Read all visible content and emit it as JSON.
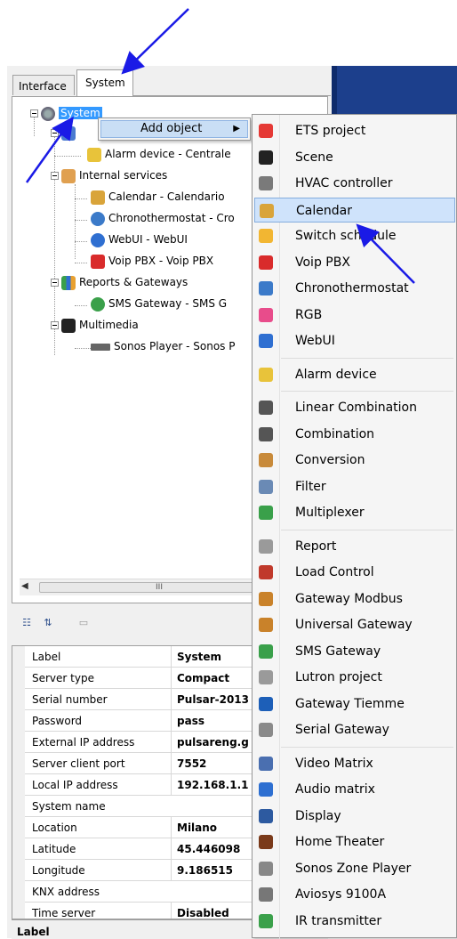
{
  "tabs": [
    "Interface",
    "System"
  ],
  "tree": {
    "root": "System",
    "items": [
      "Alarm device - Centrale",
      "Internal services",
      "Calendar - Calendario",
      "Chronothermostat - Cro",
      "WebUI - WebUI",
      "Voip PBX - Voip PBX",
      "Reports & Gateways",
      "SMS Gateway - SMS G",
      "Multimedia",
      "Sonos Player - Sonos P"
    ]
  },
  "scroll_thumb": "III",
  "context_menu": {
    "label": "Add object",
    "arrow": "▶"
  },
  "submenu": [
    {
      "label": "ETS project",
      "icon": "ets-icon",
      "color": "#e53935"
    },
    {
      "label": "Scene",
      "icon": "clapper-icon",
      "color": "#222222"
    },
    {
      "label": "HVAC controller",
      "icon": "hvac-icon",
      "color": "#7a7a7a"
    },
    {
      "label": "Calendar",
      "icon": "calendar-icon",
      "color": "#d9a43a"
    },
    {
      "label": "Switch schedule",
      "icon": "schedule-icon",
      "color": "#f2b632"
    },
    {
      "label": "Voip PBX",
      "icon": "phone-icon",
      "color": "#d92b2b"
    },
    {
      "label": "Chronothermostat",
      "icon": "thermostat-icon",
      "color": "#3b7ac9"
    },
    {
      "label": "RGB",
      "icon": "rgb-icon",
      "color": "#e84c8b"
    },
    {
      "label": "WebUI",
      "icon": "globe-icon",
      "color": "#2f6fd1"
    },
    {
      "label": "Alarm device",
      "icon": "bell-icon",
      "color": "#e8c33a"
    },
    {
      "label": "Linear Combination",
      "icon": "sigma-icon",
      "color": "#555555"
    },
    {
      "label": "Combination",
      "icon": "combination-icon",
      "color": "#555555"
    },
    {
      "label": "Conversion",
      "icon": "pencil-icon",
      "color": "#c88a3a"
    },
    {
      "label": "Filter",
      "icon": "filter-icon",
      "color": "#6a8ab5"
    },
    {
      "label": "Multiplexer",
      "icon": "multiplexer-icon",
      "color": "#3aa04a"
    },
    {
      "label": "Report",
      "icon": "report-icon",
      "color": "#9a9a9a"
    },
    {
      "label": "Load Control",
      "icon": "load-icon",
      "color": "#c0392b"
    },
    {
      "label": "Gateway Modbus",
      "icon": "modbus-icon",
      "color": "#c9822a"
    },
    {
      "label": "Universal Gateway",
      "icon": "gateway-icon",
      "color": "#c9822a"
    },
    {
      "label": "SMS Gateway",
      "icon": "sms-icon",
      "color": "#3aa04a"
    },
    {
      "label": "Lutron project",
      "icon": "lutron-icon",
      "color": "#9a9a9a"
    },
    {
      "label": "Gateway Tiemme",
      "icon": "tiemme-icon",
      "color": "#1d5fb8"
    },
    {
      "label": "Serial Gateway",
      "icon": "serial-icon",
      "color": "#8a8a8a"
    },
    {
      "label": "Video Matrix",
      "icon": "video-matrix-icon",
      "color": "#4a6fb0"
    },
    {
      "label": "Audio matrix",
      "icon": "music-icon",
      "color": "#2d6fd1"
    },
    {
      "label": "Display",
      "icon": "display-icon",
      "color": "#2d5aa0"
    },
    {
      "label": "Home Theater",
      "icon": "speaker-icon",
      "color": "#7a3a1a"
    },
    {
      "label": "Sonos Zone Player",
      "icon": "sonos-icon",
      "color": "#888888"
    },
    {
      "label": "Aviosys 9100A",
      "icon": "aviosys-icon",
      "color": "#777777"
    },
    {
      "label": "IR transmitter",
      "icon": "ir-icon",
      "color": "#3aa04a"
    }
  ],
  "properties": [
    {
      "name": "Label",
      "value": "System"
    },
    {
      "name": "Server type",
      "value": "Compact"
    },
    {
      "name": "Serial number",
      "value": "Pulsar-2013"
    },
    {
      "name": "Password",
      "value": "pass"
    },
    {
      "name": "External IP address",
      "value": "pulsareng.g"
    },
    {
      "name": "Server client port",
      "value": "7552"
    },
    {
      "name": "Local IP address",
      "value": "192.168.1.1"
    },
    {
      "name": "System name",
      "value": ""
    },
    {
      "name": "Location",
      "value": "Milano"
    },
    {
      "name": "Latitude",
      "value": "45.446098"
    },
    {
      "name": "Longitude",
      "value": "9.186515"
    },
    {
      "name": "KNX address",
      "value": ""
    },
    {
      "name": "Time server",
      "value": "Disabled"
    }
  ],
  "description_label": "Label"
}
